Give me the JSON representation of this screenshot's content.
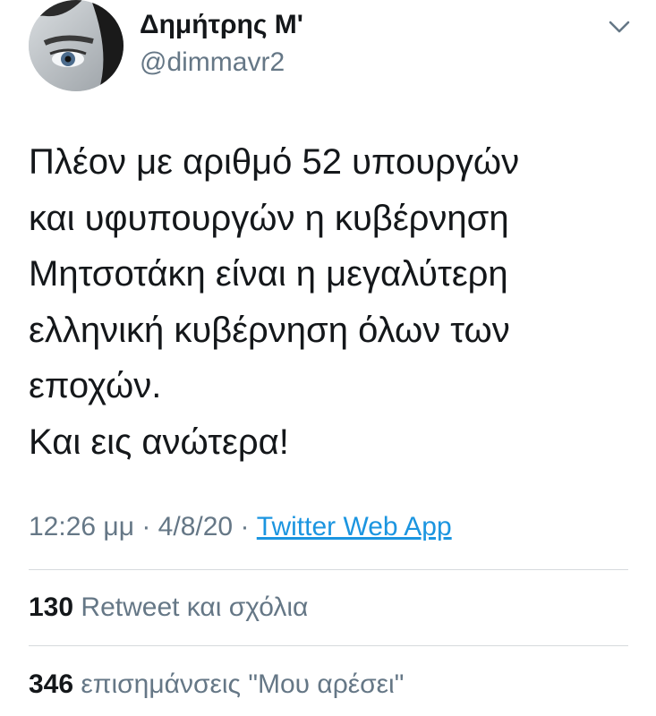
{
  "author": {
    "name": "Δημήτρης Μ'",
    "handle": "@dimmavr2"
  },
  "tweet": {
    "lines": [
      "Πλέον με αριθμό 52 υπουργών",
      "και υφυπουργών η κυβέρνηση",
      "Μητσοτάκη είναι η μεγαλύτερη",
      "ελληνική κυβέρνηση όλων των",
      "εποχών.",
      "Και εις ανώτερα!"
    ],
    "time": "12:26 μμ",
    "separator": "·",
    "date": "4/8/20",
    "source": "Twitter Web App"
  },
  "stats": {
    "retweets_count": "130",
    "retweets_label": "Retweet και σχόλια",
    "likes_count": "346",
    "likes_label": "επισημάνσεις \"Μου αρέσει\""
  },
  "icons": {
    "menu": "chevron-down-icon"
  },
  "colors": {
    "text": "#14171a",
    "secondary": "#657786",
    "link": "#1b95e0",
    "divider": "#d6dadd"
  }
}
